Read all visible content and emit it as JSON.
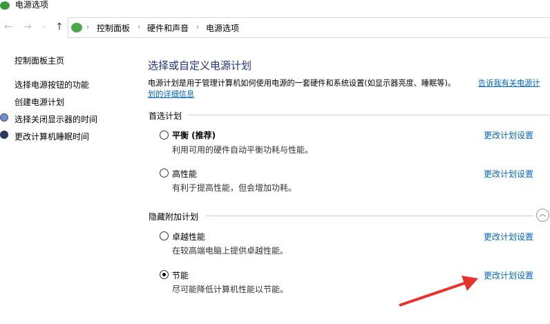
{
  "window": {
    "title": "电源选项"
  },
  "breadcrumb": [
    "控制面板",
    "硬件和声音",
    "电源选项"
  ],
  "sidebar": {
    "home": "控制面板主页",
    "items": [
      "选择电源按钮的功能",
      "创建电源计划",
      "选择关闭显示器的时间",
      "更改计算机睡眠时间"
    ]
  },
  "main": {
    "heading": "选择或自定义电源计划",
    "description": "电源计划是用于管理计算机如何使用电源的一套硬件和系统设置(如显示器亮度、睡眠等)。",
    "learn_more_a": "告诉我有关电源计",
    "learn_more_b": "划的详细信息",
    "preferred_label": "首选计划",
    "hidden_label": "隐藏附加计划",
    "change_label": "更改计划设置",
    "plans": [
      {
        "name": "平衡 (推荐)",
        "desc": "利用可用的硬件自动平衡功耗与性能。",
        "selected": false
      },
      {
        "name": "高性能",
        "desc": "有利于提高性能，但会增加功耗。",
        "selected": false
      },
      {
        "name": "卓越性能",
        "desc": "在较高端电脑上提供卓越性能。",
        "selected": false
      },
      {
        "name": "节能",
        "desc": "尽可能降低计算机性能以节能。",
        "selected": true
      }
    ]
  },
  "colors": {
    "heading": "#1e3287",
    "link": "#0066cc",
    "arrow": "#e8322a"
  }
}
